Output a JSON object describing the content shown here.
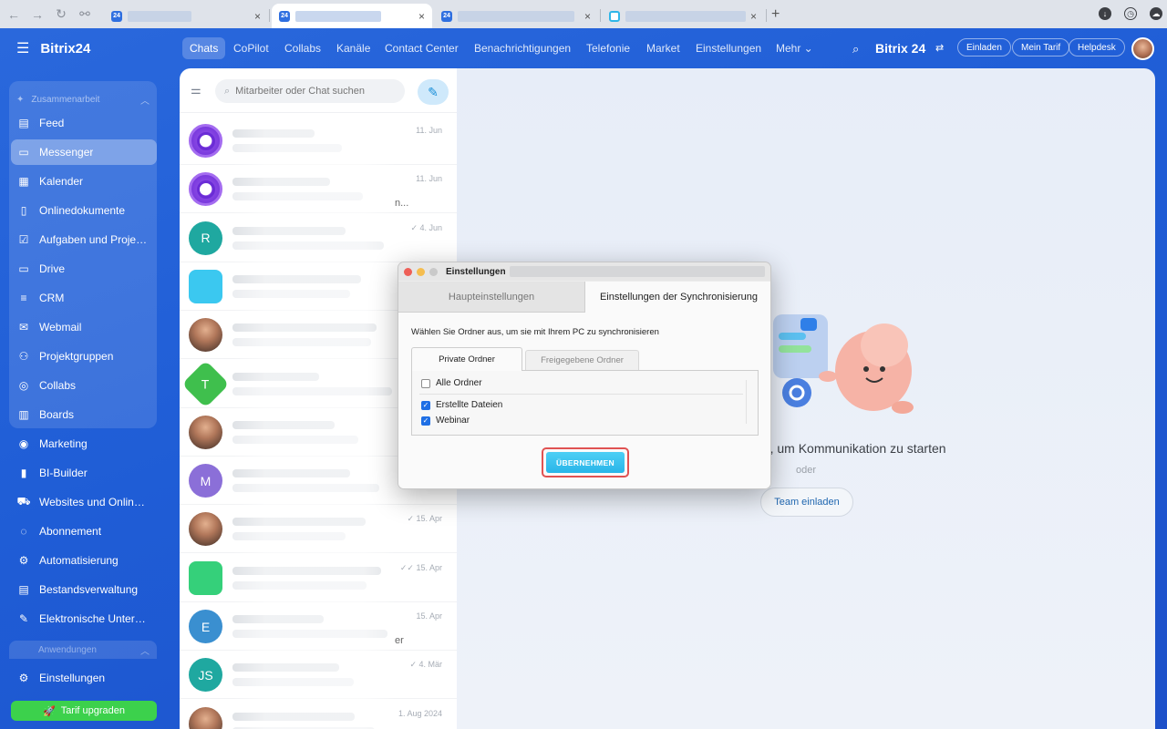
{
  "browser": {
    "tabs": [
      {
        "favicon": "24",
        "active": false
      },
      {
        "favicon": "24",
        "active": true
      },
      {
        "favicon": "24",
        "active": false
      },
      {
        "favicon": "bitrix-cloud",
        "active": false
      }
    ],
    "close_glyph": "×",
    "new_tab_glyph": "+"
  },
  "sidebar": {
    "brand": "Bitrix24",
    "group_title": "Zusammenarbeit",
    "items": [
      {
        "label": "Feed",
        "icon": "feed-icon",
        "glyph": "▤"
      },
      {
        "label": "Messenger",
        "icon": "chat-icon",
        "glyph": "▭",
        "active": true
      },
      {
        "label": "Kalender",
        "icon": "calendar-icon",
        "glyph": "▦"
      },
      {
        "label": "Onlinedokumente",
        "icon": "document-icon",
        "glyph": "▯"
      },
      {
        "label": "Aufgaben und Projekte",
        "icon": "tasks-icon",
        "glyph": "☑"
      },
      {
        "label": "Drive",
        "icon": "drive-icon",
        "glyph": "▭"
      },
      {
        "label": "CRM",
        "icon": "crm-icon",
        "glyph": "≡"
      },
      {
        "label": "Webmail",
        "icon": "mail-icon",
        "glyph": "✉"
      },
      {
        "label": "Projektgruppen",
        "icon": "groups-icon",
        "glyph": "⚇"
      },
      {
        "label": "Collabs",
        "icon": "collabs-icon",
        "glyph": "◎"
      },
      {
        "label": "Boards",
        "icon": "boards-icon",
        "glyph": "▥"
      },
      {
        "label": "Marketing",
        "icon": "marketing-icon",
        "glyph": "◉"
      },
      {
        "label": "BI-Builder",
        "icon": "bi-icon",
        "glyph": "▮"
      },
      {
        "label": "Websites und Onlineshops",
        "icon": "cart-icon",
        "glyph": "⛟"
      },
      {
        "label": "Abonnement",
        "icon": "subscription-icon",
        "glyph": "◌"
      },
      {
        "label": "Automatisierung",
        "icon": "automation-icon",
        "glyph": "⚙"
      },
      {
        "label": "Bestandsverwaltung",
        "icon": "inventory-icon",
        "glyph": "▤"
      },
      {
        "label": "Elektronische Unterschrift",
        "icon": "signature-icon",
        "glyph": "✎"
      }
    ],
    "footer_group": "Anwendungen",
    "settings": "Einstellungen",
    "upgrade": "Tarif upgraden"
  },
  "topnav": {
    "tabs": [
      "Chats",
      "CoPilot",
      "Collabs",
      "Kanäle",
      "Contact Center",
      "Benachrichtigungen",
      "Telefonie",
      "Market",
      "Einstellungen",
      "Mehr ⌄"
    ],
    "brand": "Bitrix 24",
    "buttons": [
      "Einladen",
      "Mein Tarif",
      "Helpdesk"
    ]
  },
  "chat_list": {
    "search_placeholder": "Mitarbeiter oder Chat suchen",
    "rows": [
      {
        "avatar": "copilot",
        "date": "11. Jun"
      },
      {
        "avatar": "copilot",
        "date": "11. Jun",
        "snippet": "n..."
      },
      {
        "avatar": "R",
        "color": "#1fa8a0",
        "date": "✓ 4. Jun"
      },
      {
        "avatar": "cyan-sq",
        "date": ""
      },
      {
        "avatar": "photo",
        "date": ""
      },
      {
        "avatar": "T",
        "color": "#3fbf4d",
        "date": ""
      },
      {
        "avatar": "photo",
        "date": ""
      },
      {
        "avatar": "M",
        "color": "#8b6fd8",
        "date": ""
      },
      {
        "avatar": "photo",
        "date": "✓ 15. Apr"
      },
      {
        "avatar": "green-sq",
        "date": "✓✓ 15. Apr"
      },
      {
        "avatar": "E",
        "color": "#3a8fd0",
        "date": "15. Apr",
        "snippet": "er"
      },
      {
        "avatar": "JS",
        "color": "#1fa8a0",
        "date": "✓ 4. Mär"
      },
      {
        "avatar": "photo",
        "date": "1. Aug 2024"
      }
    ]
  },
  "main": {
    "empty_title": "aus, um Kommunikation zu starten",
    "or": "oder",
    "invite": "Team einladen"
  },
  "modal": {
    "title": "Einstellungen",
    "tab_main": "Haupteinstellungen",
    "tab_sync": "Einstellungen der Synchronisierung",
    "description": "Wählen Sie Ordner aus, um sie mit Ihrem PC zu synchronisieren",
    "subtab_private": "Private Ordner",
    "subtab_shared": "Freigegebene Ordner",
    "all_folders": "Alle Ordner",
    "folders": [
      {
        "label": "Erstellte Dateien",
        "checked": true
      },
      {
        "label": "Webinar",
        "checked": true
      }
    ],
    "apply": "ÜBERNEHMEN"
  }
}
